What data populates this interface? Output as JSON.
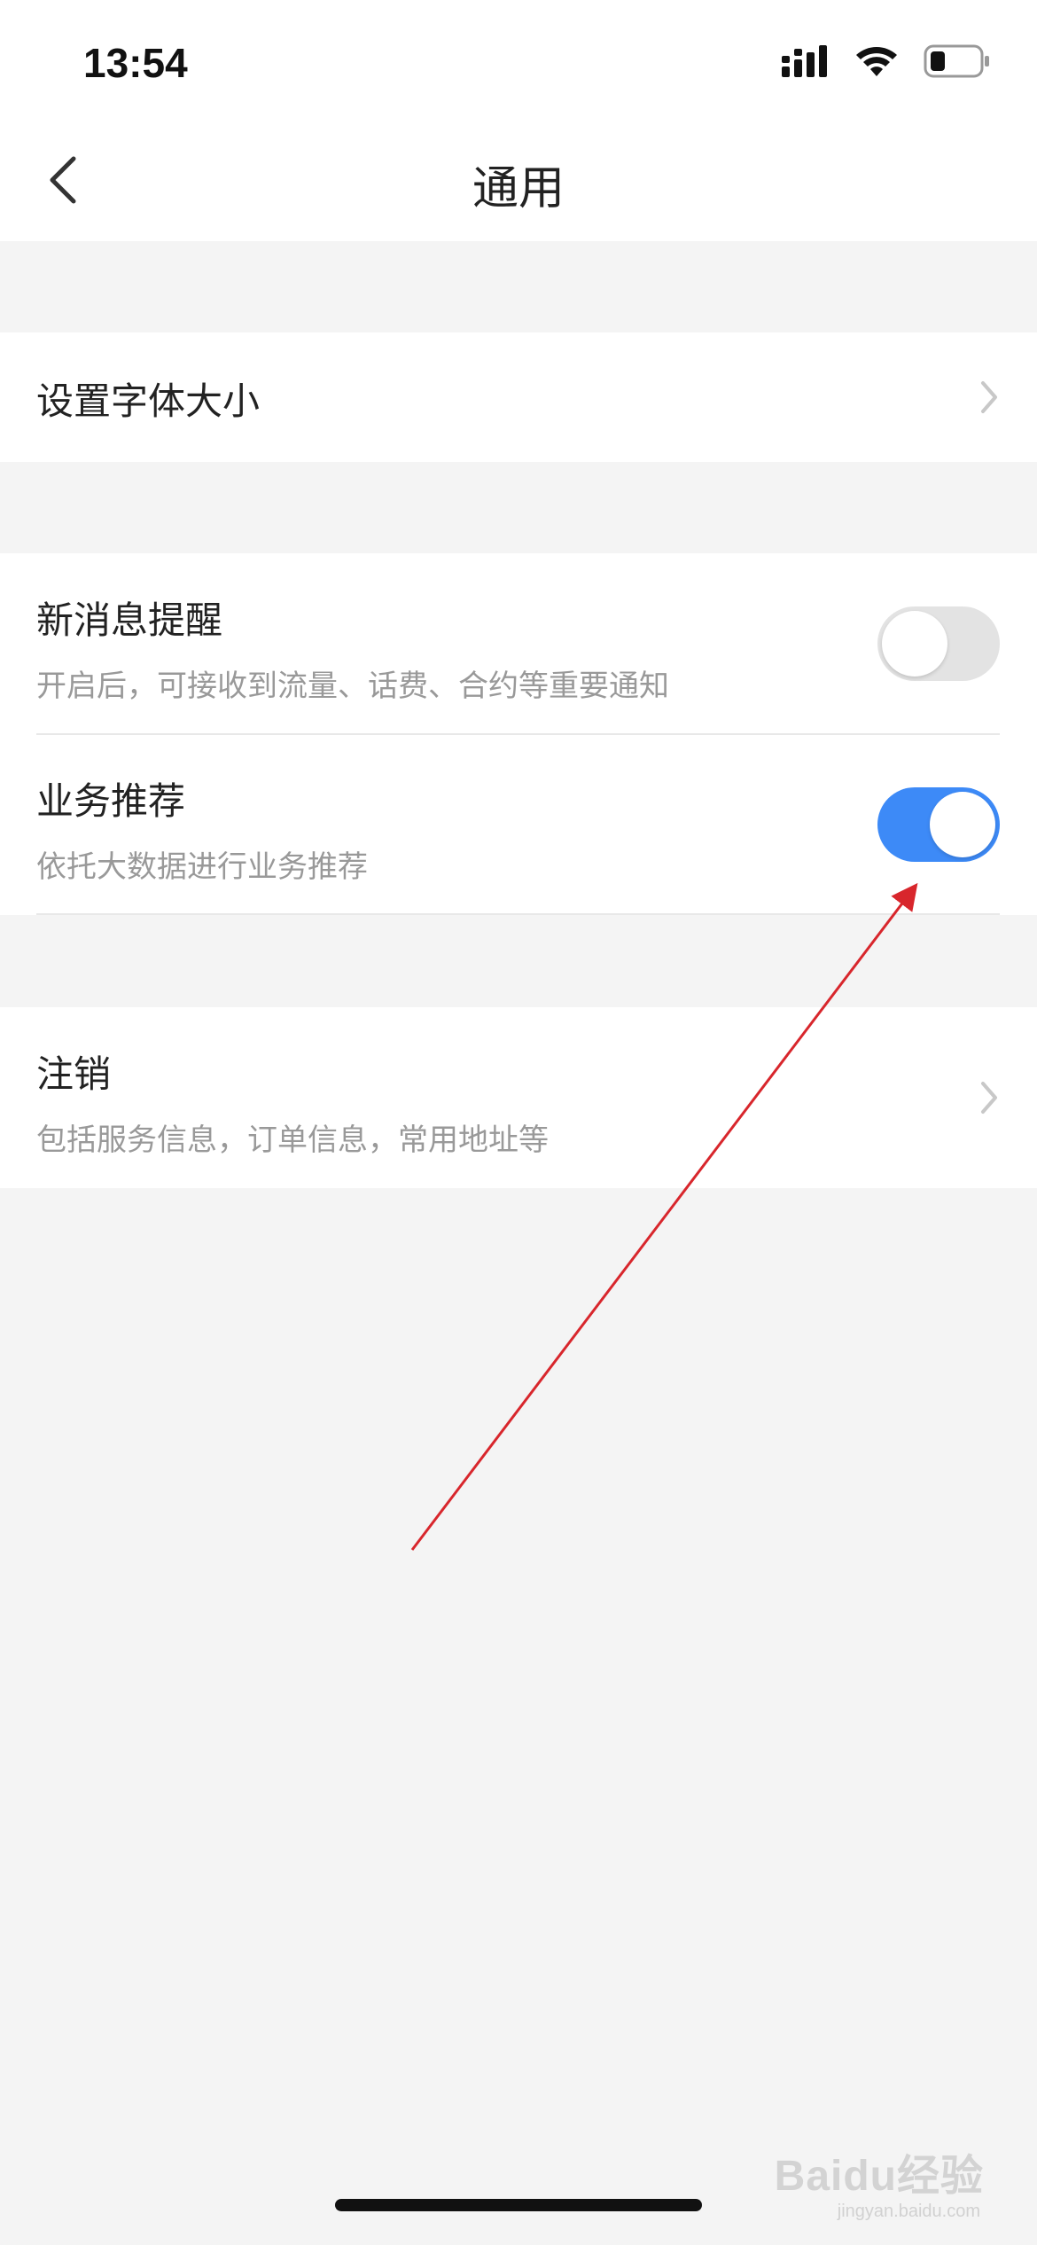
{
  "status_bar": {
    "time": "13:54",
    "icons": [
      "signal-icon",
      "wifi-icon",
      "battery-icon"
    ]
  },
  "nav": {
    "back_icon": "chevron-left-icon",
    "title": "通用"
  },
  "settings": {
    "font_size": {
      "title": "设置字体大小",
      "chevron_icon": "chevron-right-icon"
    },
    "new_message": {
      "title": "新消息提醒",
      "subtitle": "开启后，可接收到流量、话费、合约等重要通知",
      "toggle_on": false
    },
    "business_recommend": {
      "title": "业务推荐",
      "subtitle": "依托大数据进行业务推荐",
      "toggle_on": true
    },
    "cancel_account": {
      "title": "注销",
      "subtitle": "包括服务信息，订单信息，常用地址等",
      "chevron_icon": "chevron-right-icon"
    }
  },
  "watermark": {
    "main": "Baidu经验",
    "sub": "jingyan.baidu.com"
  },
  "colors": {
    "toggle_on": "#3d8af7",
    "toggle_off": "#e3e3e3",
    "annotation_arrow": "#d8262c",
    "background": "#f4f4f4"
  }
}
